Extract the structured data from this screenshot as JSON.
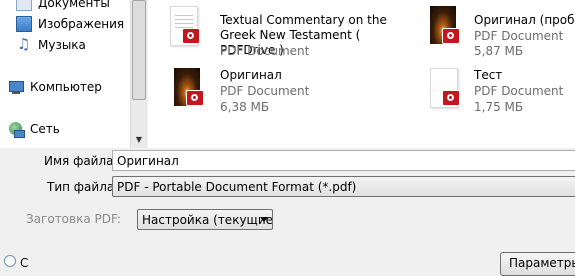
{
  "nav": {
    "items": [
      {
        "label": "Документы",
        "icon": "documents-icon"
      },
      {
        "label": "Изображения",
        "icon": "pictures-icon"
      },
      {
        "label": "Музыка",
        "icon": "music-icon"
      },
      {
        "label": "Компьютер",
        "icon": "computer-icon"
      },
      {
        "label": "Сеть",
        "icon": "network-icon"
      }
    ]
  },
  "files": [
    {
      "name": "Textual Commentary on the Greek New Testament ( PDFDrive )",
      "type": "PDF Document",
      "size": "",
      "thumbnail": "white-page"
    },
    {
      "name": "Оригинал (проба)",
      "type": "PDF Document",
      "size": "5,87 МБ",
      "thumbnail": "candle-dark"
    },
    {
      "name": "Оригинал",
      "type": "PDF Document",
      "size": "6,38 МБ",
      "thumbnail": "candle-dark"
    },
    {
      "name": "Тест",
      "type": "PDF Document",
      "size": "1,75 МБ",
      "thumbnail": "white-page"
    }
  ],
  "form": {
    "filename_label": "Имя файла:",
    "filename_value": "Оригинал",
    "filetype_label": "Тип файла:",
    "filetype_value": "PDF - Portable Document Format (*.pdf)",
    "preset_label": "Заготовка PDF:",
    "preset_value": "Настройка (текущие"
  },
  "footer": {
    "hide_folders_label": "С",
    "options_button": "Параметры"
  },
  "colors": {
    "pdf_badge": "#c4161c",
    "secondary_text": "#6d6d6d",
    "disabled_text": "#8a8a8a"
  }
}
